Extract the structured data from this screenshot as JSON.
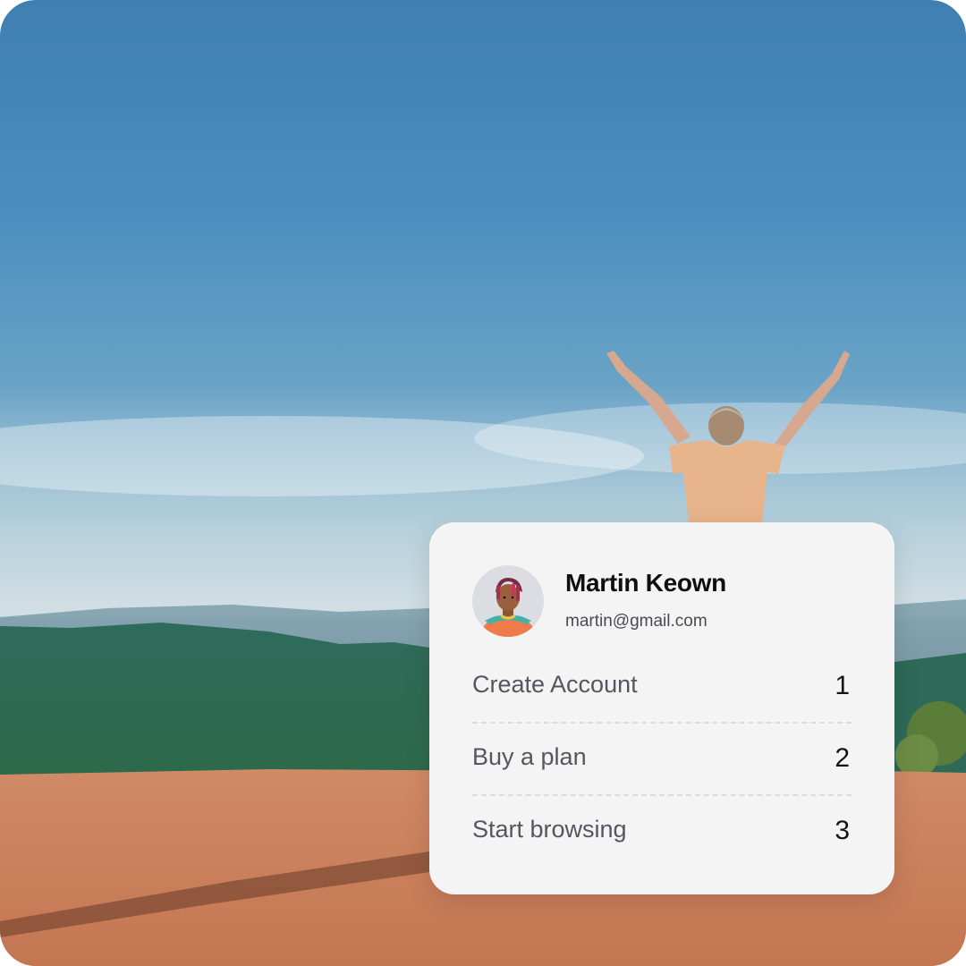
{
  "profile": {
    "name": "Martin Keown",
    "email": "martin@gmail.com",
    "avatar_icon": "illustrated-avatar"
  },
  "steps": [
    {
      "label": "Create Account",
      "number": "1"
    },
    {
      "label": "Buy a plan",
      "number": "2"
    },
    {
      "label": "Start browsing",
      "number": "3"
    }
  ],
  "colors": {
    "sky": "#4b8ebf",
    "ground": "#c97a58",
    "card_background": "#f4f4f5"
  }
}
